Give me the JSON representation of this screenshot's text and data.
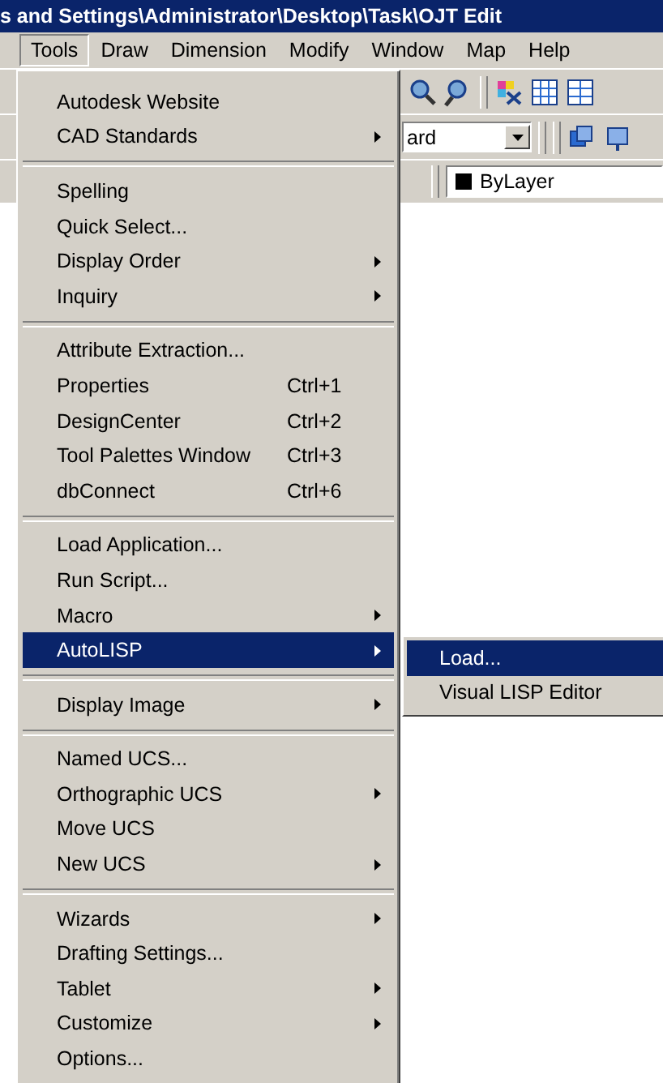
{
  "window": {
    "title": "s and Settings\\Administrator\\Desktop\\Task\\OJT Edit"
  },
  "menu_bar": [
    {
      "label": "Tools",
      "selected": true
    },
    {
      "label": "Draw",
      "selected": false
    },
    {
      "label": "Dimension",
      "selected": false
    },
    {
      "label": "Modify",
      "selected": false
    },
    {
      "label": "Window",
      "selected": false
    },
    {
      "label": "Map",
      "selected": false
    },
    {
      "label": "Help",
      "selected": false
    }
  ],
  "toolbar": {
    "style_combo": "ard",
    "layer_field": "ByLayer"
  },
  "tools_menu": {
    "sections": [
      [
        {
          "label": "Autodesk Website",
          "submenu": false,
          "selected": false
        },
        {
          "label": "CAD Standards",
          "submenu": true,
          "selected": false
        }
      ],
      [
        {
          "label": "Spelling",
          "submenu": false,
          "selected": false
        },
        {
          "label": "Quick Select...",
          "submenu": false,
          "selected": false
        },
        {
          "label": "Display Order",
          "submenu": true,
          "selected": false
        },
        {
          "label": "Inquiry",
          "submenu": true,
          "selected": false
        }
      ],
      [
        {
          "label": "Attribute Extraction...",
          "submenu": false,
          "selected": false
        },
        {
          "label": "Properties",
          "shortcut": "Ctrl+1",
          "submenu": false,
          "selected": false
        },
        {
          "label": "DesignCenter",
          "shortcut": "Ctrl+2",
          "submenu": false,
          "selected": false
        },
        {
          "label": "Tool Palettes Window",
          "shortcut": "Ctrl+3",
          "submenu": false,
          "selected": false
        },
        {
          "label": "dbConnect",
          "shortcut": "Ctrl+6",
          "submenu": false,
          "selected": false
        }
      ],
      [
        {
          "label": "Load Application...",
          "submenu": false,
          "selected": false
        },
        {
          "label": "Run Script...",
          "submenu": false,
          "selected": false
        },
        {
          "label": "Macro",
          "submenu": true,
          "selected": false
        },
        {
          "label": "AutoLISP",
          "submenu": true,
          "selected": true
        }
      ],
      [
        {
          "label": "Display Image",
          "submenu": true,
          "selected": false
        }
      ],
      [
        {
          "label": "Named UCS...",
          "submenu": false,
          "selected": false
        },
        {
          "label": "Orthographic UCS",
          "submenu": true,
          "selected": false
        },
        {
          "label": "Move UCS",
          "submenu": false,
          "selected": false
        },
        {
          "label": "New UCS",
          "submenu": true,
          "selected": false
        }
      ],
      [
        {
          "label": "Wizards",
          "submenu": true,
          "selected": false
        },
        {
          "label": "Drafting Settings...",
          "submenu": false,
          "selected": false
        },
        {
          "label": "Tablet",
          "submenu": true,
          "selected": false
        },
        {
          "label": "Customize",
          "submenu": true,
          "selected": false
        },
        {
          "label": "Options...",
          "submenu": false,
          "selected": false
        }
      ]
    ]
  },
  "autolisp_submenu": [
    {
      "label": "Load...",
      "selected": true
    },
    {
      "label": "Visual LISP Editor",
      "selected": false
    }
  ]
}
